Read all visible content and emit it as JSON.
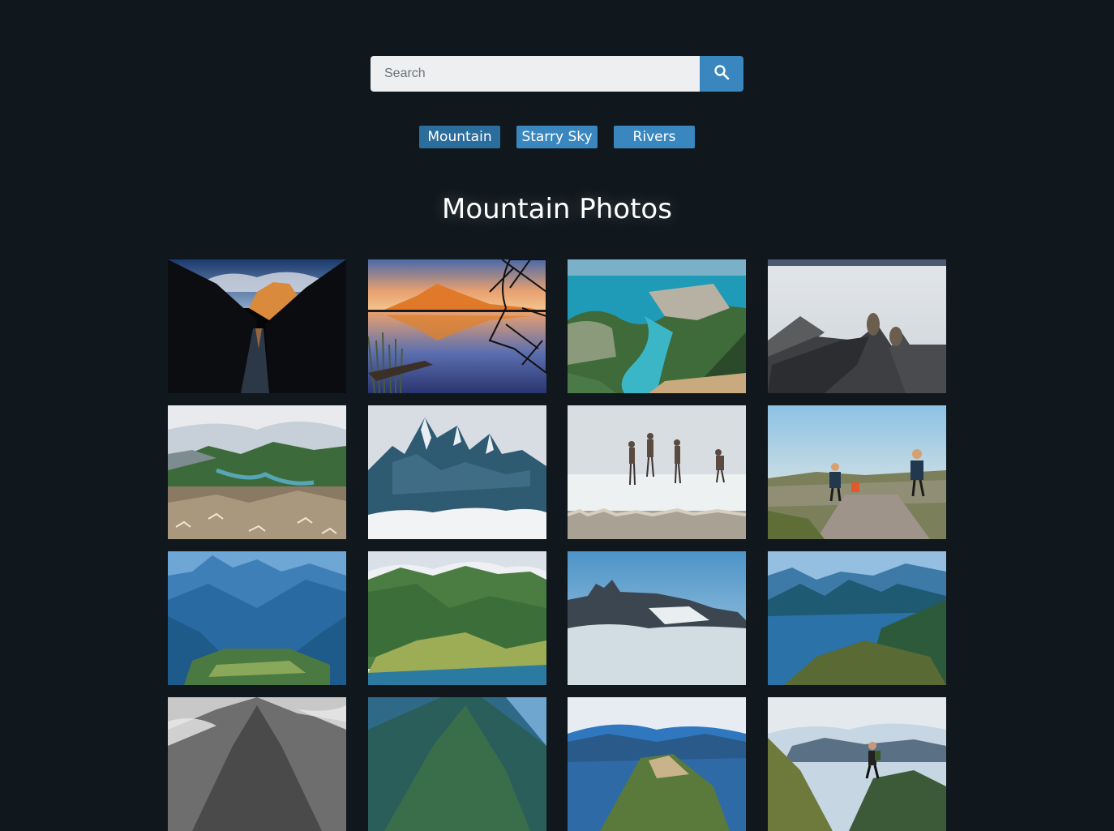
{
  "search": {
    "placeholder": "Search",
    "value": ""
  },
  "filters": [
    {
      "label": "Mountain",
      "color": "#2b6d9c"
    },
    {
      "label": "Starry Sky",
      "color": "#3a87c0"
    },
    {
      "label": "Rivers",
      "color": "#3a87c0"
    }
  ],
  "page_title": "Mountain Photos",
  "colors": {
    "background": "#10181d",
    "accent": "#3a87c0",
    "input_bg": "#edeff1"
  },
  "photos": [
    {
      "name": "canyon-reflection"
    },
    {
      "name": "sunset-lake-reflection"
    },
    {
      "name": "river-delta-aerial"
    },
    {
      "name": "feet-over-clouds"
    },
    {
      "name": "valley-river-view"
    },
    {
      "name": "jagged-peaks-above-clouds"
    },
    {
      "name": "hikers-in-fog"
    },
    {
      "name": "hikers-on-trail"
    },
    {
      "name": "blue-valley"
    },
    {
      "name": "green-mountain-slopes"
    },
    {
      "name": "cliffs-above-clouds"
    },
    {
      "name": "fjord-view"
    },
    {
      "name": "misty-mountain-bw"
    },
    {
      "name": "green-mountain-peak"
    },
    {
      "name": "ridge-over-fjord"
    },
    {
      "name": "hiker-on-summit"
    }
  ]
}
